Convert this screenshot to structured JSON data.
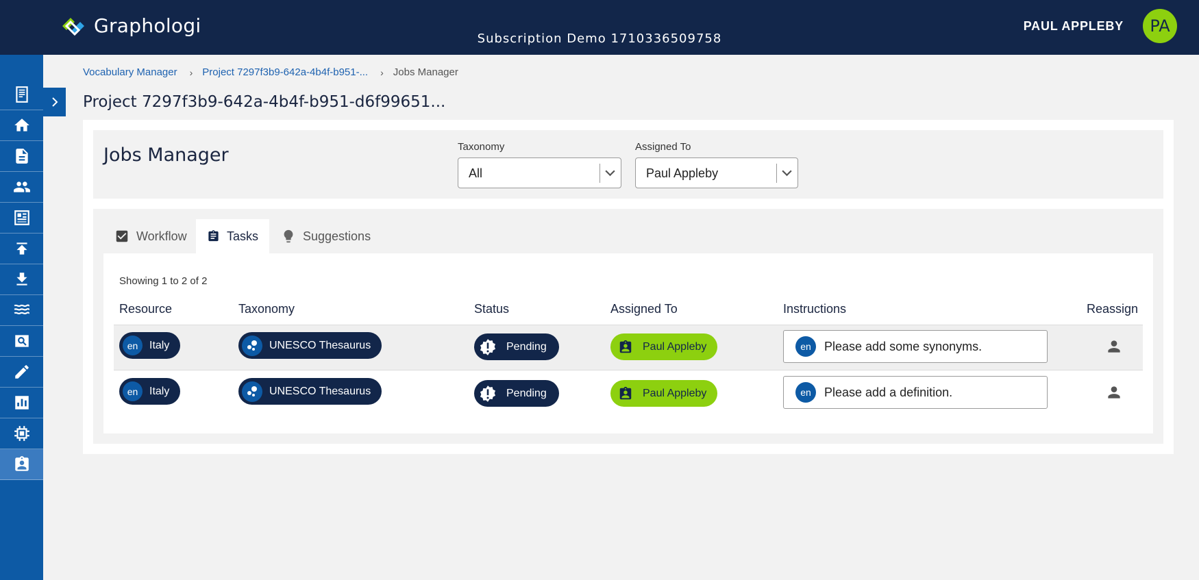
{
  "header": {
    "app_name": "Graphologi",
    "subscription": "Subscription Demo 1710336509758",
    "user_name": "PAUL APPLEBY",
    "user_initials": "PA"
  },
  "sidebar": {
    "items": [
      {
        "icon": "document-icon"
      },
      {
        "icon": "home-icon"
      },
      {
        "icon": "file-icon"
      },
      {
        "icon": "people-icon"
      },
      {
        "icon": "dashboard-icon"
      },
      {
        "icon": "upload-icon"
      },
      {
        "icon": "download-icon"
      },
      {
        "icon": "waves-icon"
      },
      {
        "icon": "search-box-icon"
      },
      {
        "icon": "pencil-icon"
      },
      {
        "icon": "bar-chart-icon"
      },
      {
        "icon": "chip-icon"
      },
      {
        "icon": "assignment-ind-icon",
        "active": true
      }
    ]
  },
  "breadcrumb": {
    "items": [
      "Vocabulary Manager",
      "Project 7297f3b9-642a-4b4f-b951-...",
      "Jobs Manager"
    ],
    "separator": "›"
  },
  "page": {
    "title": "Project 7297f3b9-642a-4b4f-b951-d6f99651..."
  },
  "jobs": {
    "title": "Jobs Manager",
    "filters": {
      "taxonomy_label": "Taxonomy",
      "taxonomy_value": "All",
      "assigned_label": "Assigned To",
      "assigned_value": "Paul Appleby"
    },
    "tabs": [
      {
        "label": "Workflow",
        "icon": "checkbox-icon"
      },
      {
        "label": "Tasks",
        "icon": "clipboard-icon",
        "active": true
      },
      {
        "label": "Suggestions",
        "icon": "lightbulb-icon"
      }
    ],
    "showing": "Showing 1 to 2 of 2",
    "columns": [
      "Resource",
      "Taxonomy",
      "Status",
      "Assigned To",
      "Instructions",
      "Reassign"
    ],
    "rows": [
      {
        "lang": "en",
        "resource": "Italy",
        "taxonomy": "UNESCO Thesaurus",
        "status": "Pending",
        "assigned_to": "Paul Appleby",
        "instr_lang": "en",
        "instructions": "Please add some synonyms."
      },
      {
        "lang": "en",
        "resource": "Italy",
        "taxonomy": "UNESCO Thesaurus",
        "status": "Pending",
        "assigned_to": "Paul Appleby",
        "instr_lang": "en",
        "instructions": "Please add a definition."
      }
    ]
  },
  "colors": {
    "navy": "#12264a",
    "blue": "#0d5aa5",
    "lime": "#8dd00f"
  }
}
